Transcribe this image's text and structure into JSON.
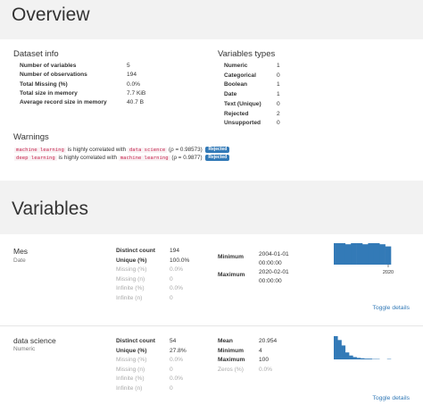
{
  "overview": {
    "title": "Overview",
    "dataset_info": {
      "heading": "Dataset info",
      "rows": [
        {
          "label": "Number of variables",
          "value": "5"
        },
        {
          "label": "Number of observations",
          "value": "194"
        },
        {
          "label": "Total Missing (%)",
          "value": "0.0%"
        },
        {
          "label": "Total size in memory",
          "value": "7.7 KiB"
        },
        {
          "label": "Average record size in memory",
          "value": "40.7 B"
        }
      ]
    },
    "variable_types": {
      "heading": "Variables types",
      "rows": [
        {
          "label": "Numeric",
          "value": "1"
        },
        {
          "label": "Categorical",
          "value": "0"
        },
        {
          "label": "Boolean",
          "value": "1"
        },
        {
          "label": "Date",
          "value": "1"
        },
        {
          "label": "Text (Unique)",
          "value": "0"
        },
        {
          "label": "Rejected",
          "value": "2"
        },
        {
          "label": "Unsupported",
          "value": "0"
        }
      ]
    },
    "warnings": {
      "heading": "Warnings",
      "items": [
        {
          "var": "machine learning",
          "mid": "is highly correlated with",
          "other": "data science",
          "rho": "(ρ = 0.98573)",
          "badge": "Rejected"
        },
        {
          "var": "deep learning",
          "mid": "is highly correlated with",
          "other": "machine learning",
          "rho": "(ρ = 0.9877)",
          "badge": "Rejected"
        }
      ]
    }
  },
  "variables": {
    "title": "Variables",
    "items": [
      {
        "name": "Mes",
        "type": "Date",
        "stats_left": [
          {
            "label": "Distinct count",
            "value": "194",
            "muted": false
          },
          {
            "label": "Unique (%)",
            "value": "100.0%",
            "muted": false
          },
          {
            "label": "Missing (%)",
            "value": "0.0%",
            "muted": true
          },
          {
            "label": "Missing (n)",
            "value": "0",
            "muted": true
          },
          {
            "label": "Infinite (%)",
            "value": "0.0%",
            "muted": true
          },
          {
            "label": "Infinite (n)",
            "value": "0",
            "muted": true
          }
        ],
        "stats_right": [
          {
            "label": "Minimum",
            "value": "2004-01-01 00:00:00"
          },
          {
            "label": "Maximum",
            "value": "2020-02-01 00:00:00"
          }
        ],
        "hist_tick": "2020",
        "toggle": "Toggle details",
        "color": "#337ab7"
      },
      {
        "name": "data science",
        "type": "Numeric",
        "stats_left": [
          {
            "label": "Distinct count",
            "value": "54",
            "muted": false
          },
          {
            "label": "Unique (%)",
            "value": "27.8%",
            "muted": false
          },
          {
            "label": "Missing (%)",
            "value": "0.0%",
            "muted": true
          },
          {
            "label": "Missing (n)",
            "value": "0",
            "muted": true
          },
          {
            "label": "Infinite (%)",
            "value": "0.0%",
            "muted": true
          },
          {
            "label": "Infinite (n)",
            "value": "0",
            "muted": true
          }
        ],
        "stats_right": [
          {
            "label": "Mean",
            "value": "20.954",
            "muted": false
          },
          {
            "label": "Minimum",
            "value": "4",
            "muted": false
          },
          {
            "label": "Maximum",
            "value": "100",
            "muted": false
          },
          {
            "label": "Zeros (%)",
            "value": "0.0%",
            "muted": true
          }
        ],
        "toggle": "Toggle details",
        "color": "#337ab7"
      }
    ]
  },
  "chart_data": [
    {
      "type": "bar",
      "title": "",
      "categories": [
        "b1",
        "b2",
        "b3",
        "b4",
        "b5",
        "b6",
        "b7",
        "b8",
        "b9",
        "b10"
      ],
      "values": [
        20,
        20,
        19,
        20,
        20,
        19,
        20,
        20,
        19,
        17
      ],
      "xticks": [
        "2020"
      ]
    },
    {
      "type": "bar",
      "title": "",
      "categories": [
        "b1",
        "b2",
        "b3",
        "b4",
        "b5",
        "b6",
        "b7",
        "b8",
        "b9",
        "b10",
        "b11",
        "b12",
        "b13",
        "b14",
        "b15"
      ],
      "values": [
        60,
        50,
        36,
        18,
        10,
        6,
        4,
        3,
        2,
        2,
        1,
        1,
        0,
        0,
        1
      ]
    }
  ]
}
